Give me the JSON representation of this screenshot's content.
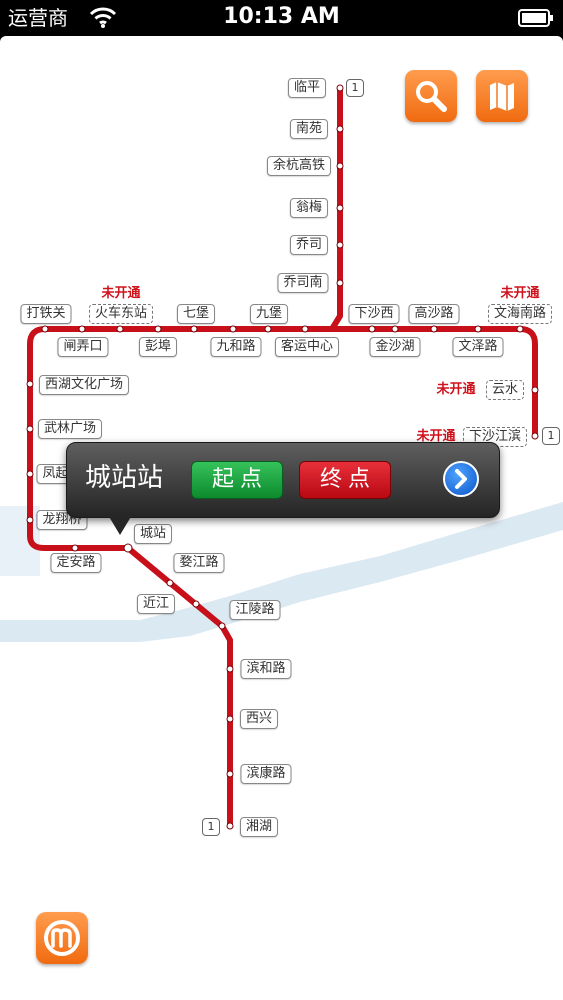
{
  "status_bar": {
    "carrier": "运营商",
    "time": "10:13 AM"
  },
  "toolbar": {
    "search_icon": "search-icon",
    "map_icon": "map-icon"
  },
  "line": {
    "number": "1",
    "color": "#c8101a"
  },
  "notices": {
    "not_open": "未开通"
  },
  "stations": {
    "linping": "临平",
    "nanyuan": "南苑",
    "yuhang_gaotie": "余杭高铁",
    "wengmei": "翁梅",
    "qiaosi": "乔司",
    "qiaosi_nan": "乔司南",
    "datieguan": "打铁关",
    "huoche_dongzhan": "火车东站",
    "qibao": "七堡",
    "jiubao": "九堡",
    "xiashaxi": "下沙西",
    "gaoshalu": "高沙路",
    "wenhai_nanlu": "文海南路",
    "zhanongkou": "闸弄口",
    "pengbu": "彭埠",
    "jiuhelu": "九和路",
    "keyun_zhongxin": "客运中心",
    "jinshahu": "金沙湖",
    "wenzelu": "文泽路",
    "xihu_wenhua_guangchang": "西湖文化广场",
    "yunshui": "云水",
    "wulin_guangchang": "武林广场",
    "xiasha_jiangbin": "下沙江滨",
    "fengqilu": "凤起路",
    "longxiangqiao": "龙翔桥",
    "chengzhan": "城站",
    "dinganlu": "定安路",
    "wujianglu": "婺江路",
    "jinjiang": "近江",
    "jianglinglu": "江陵路",
    "binhelu": "滨和路",
    "xixing": "西兴",
    "binkanglu": "滨康路",
    "xianghu": "湘湖"
  },
  "popup": {
    "station_title": "城站站",
    "start_label": "起点",
    "end_label": "终点",
    "detail_icon": "chevron-right-icon"
  },
  "logo": {
    "icon": "hangzhou-metro-logo-icon"
  }
}
